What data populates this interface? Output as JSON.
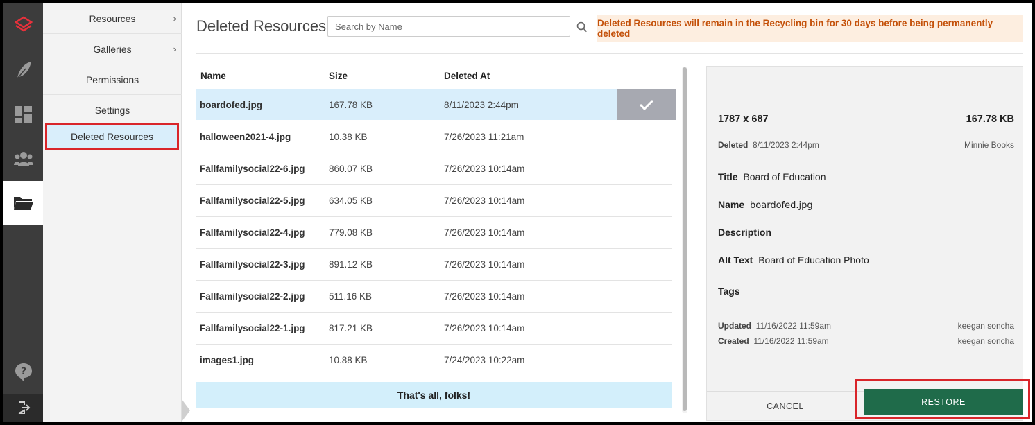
{
  "rail": {
    "icons": [
      "logo-icon",
      "feather-icon",
      "dashboard-icon",
      "users-icon",
      "folder-icon",
      "help-icon",
      "logout-icon"
    ]
  },
  "subnav": {
    "items": [
      {
        "label": "Resources",
        "has_chevron": true
      },
      {
        "label": "Galleries",
        "has_chevron": true
      },
      {
        "label": "Permissions"
      },
      {
        "label": "Settings"
      },
      {
        "label": "Deleted Resources",
        "selected": true
      }
    ]
  },
  "header": {
    "title": "Deleted Resources",
    "search_placeholder": "Search by Name",
    "notice": "Deleted Resources will remain in the Recycling bin for 30 days before being permanently deleted"
  },
  "table": {
    "columns": [
      "Name",
      "Size",
      "Deleted At"
    ],
    "rows": [
      {
        "name": "boardofed.jpg",
        "size": "167.78 KB",
        "deleted_at": "8/11/2023 2:44pm",
        "selected": true
      },
      {
        "name": "halloween2021-4.jpg",
        "size": "10.38 KB",
        "deleted_at": "7/26/2023 11:21am"
      },
      {
        "name": "Fallfamilysocial22-6.jpg",
        "size": "860.07 KB",
        "deleted_at": "7/26/2023 10:14am"
      },
      {
        "name": "Fallfamilysocial22-5.jpg",
        "size": "634.05 KB",
        "deleted_at": "7/26/2023 10:14am"
      },
      {
        "name": "Fallfamilysocial22-4.jpg",
        "size": "779.08 KB",
        "deleted_at": "7/26/2023 10:14am"
      },
      {
        "name": "Fallfamilysocial22-3.jpg",
        "size": "891.12 KB",
        "deleted_at": "7/26/2023 10:14am"
      },
      {
        "name": "Fallfamilysocial22-2.jpg",
        "size": "511.16 KB",
        "deleted_at": "7/26/2023 10:14am"
      },
      {
        "name": "Fallfamilysocial22-1.jpg",
        "size": "817.21 KB",
        "deleted_at": "7/26/2023 10:14am"
      },
      {
        "name": "images1.jpg",
        "size": "10.88 KB",
        "deleted_at": "7/24/2023 10:22am"
      }
    ],
    "end_message": "That's all, folks!"
  },
  "details": {
    "dimensions": "1787 x 687",
    "size": "167.78 KB",
    "deleted_label": "Deleted",
    "deleted_value": "8/11/2023 2:44pm",
    "deleted_by": "Minnie Books",
    "title_label": "Title",
    "title_value": "Board of Education",
    "name_label": "Name",
    "name_value": "boardofed.jpg",
    "description_label": "Description",
    "alt_label": "Alt Text",
    "alt_value": "Board of Education Photo",
    "tags_label": "Tags",
    "updated_label": "Updated",
    "updated_value": "11/16/2022 11:59am",
    "updated_by": "keegan soncha",
    "created_label": "Created",
    "created_value": "11/16/2022 11:59am",
    "created_by": "keegan soncha",
    "cancel_label": "CANCEL",
    "restore_label": "RESTORE"
  },
  "colors": {
    "rail_bg": "#3c3c3c",
    "selected_row": "#d9eefb",
    "notice_text": "#c4510a",
    "restore_bg": "#1f6b4a",
    "highlight_outline": "#d9252a"
  }
}
